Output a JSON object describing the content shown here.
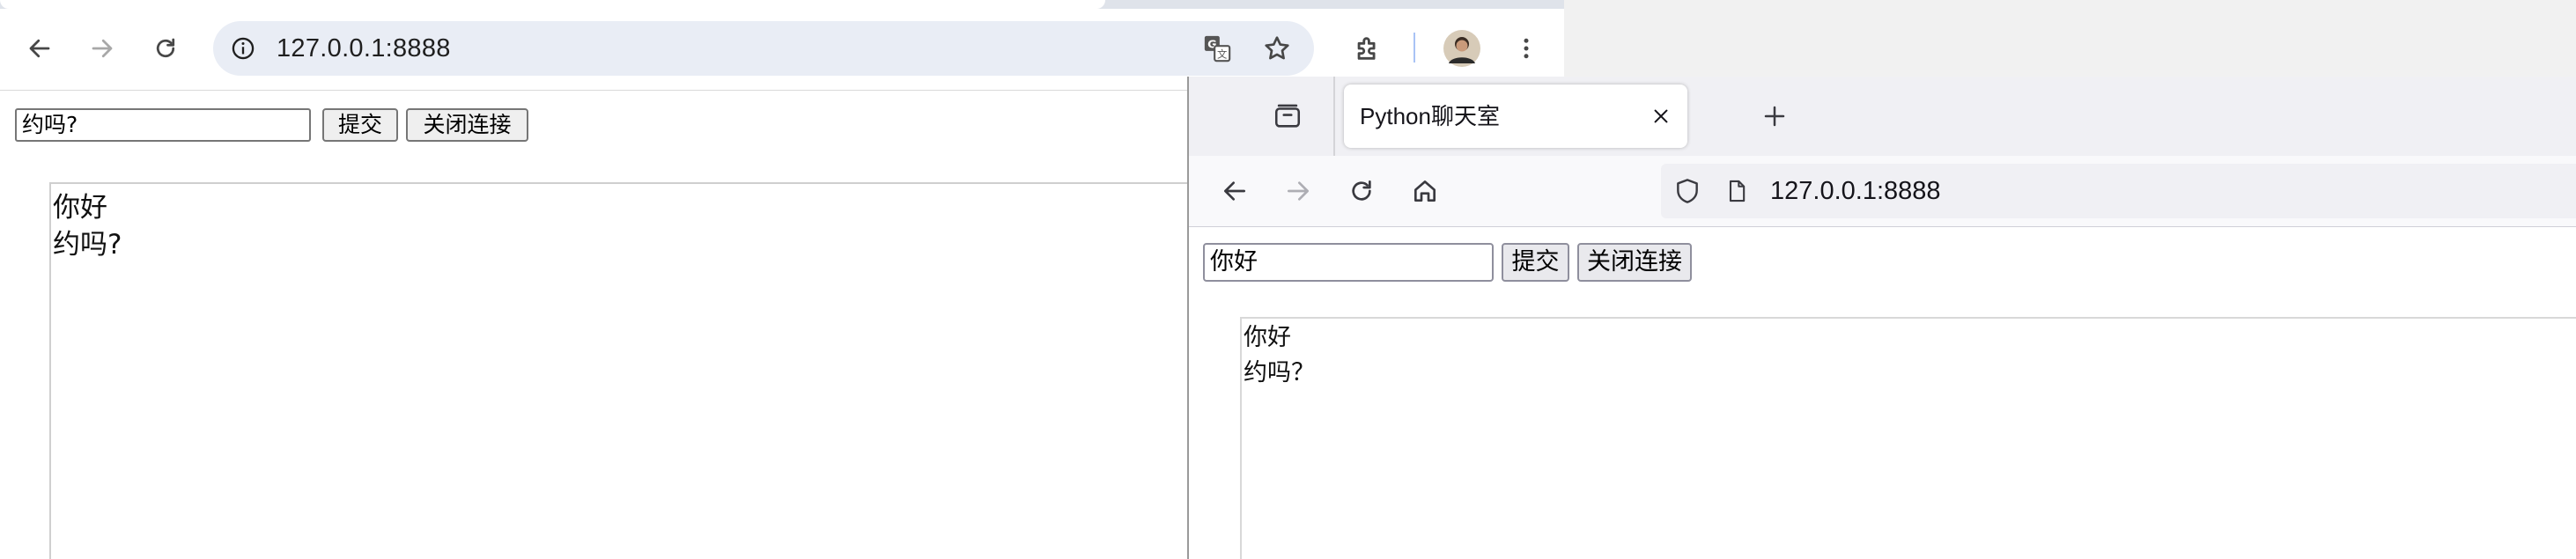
{
  "chrome_window": {
    "url": "127.0.0.1:8888",
    "icons": [
      "back-arrow-icon",
      "forward-arrow-icon",
      "reload-icon",
      "site-info-icon",
      "translate-icon",
      "bookmark-star-icon",
      "extensions-icon",
      "profile-avatar",
      "menu-kebab-icon"
    ],
    "page": {
      "input_value": "约吗?",
      "submit_label": "提交",
      "close_label": "关闭连接",
      "messages": [
        "你好",
        "约吗?"
      ]
    }
  },
  "firefox_window": {
    "tab_title": "Python聊天室",
    "url": "127.0.0.1:8888",
    "icons": [
      "tab-overview-icon",
      "tab-close-icon",
      "new-tab-plus-icon",
      "back-arrow-icon",
      "forward-arrow-icon",
      "reload-icon",
      "home-icon",
      "shield-icon",
      "page-icon"
    ],
    "page": {
      "input_value": "你好",
      "submit_label": "提交",
      "close_label": "关闭连接",
      "messages": [
        "你好",
        "约吗？"
      ]
    }
  },
  "colors": {
    "chrome_omnibox_bg": "#e9edf5",
    "firefox_tabstrip_bg": "#f0f0f4",
    "button_bg": "#efefef"
  }
}
